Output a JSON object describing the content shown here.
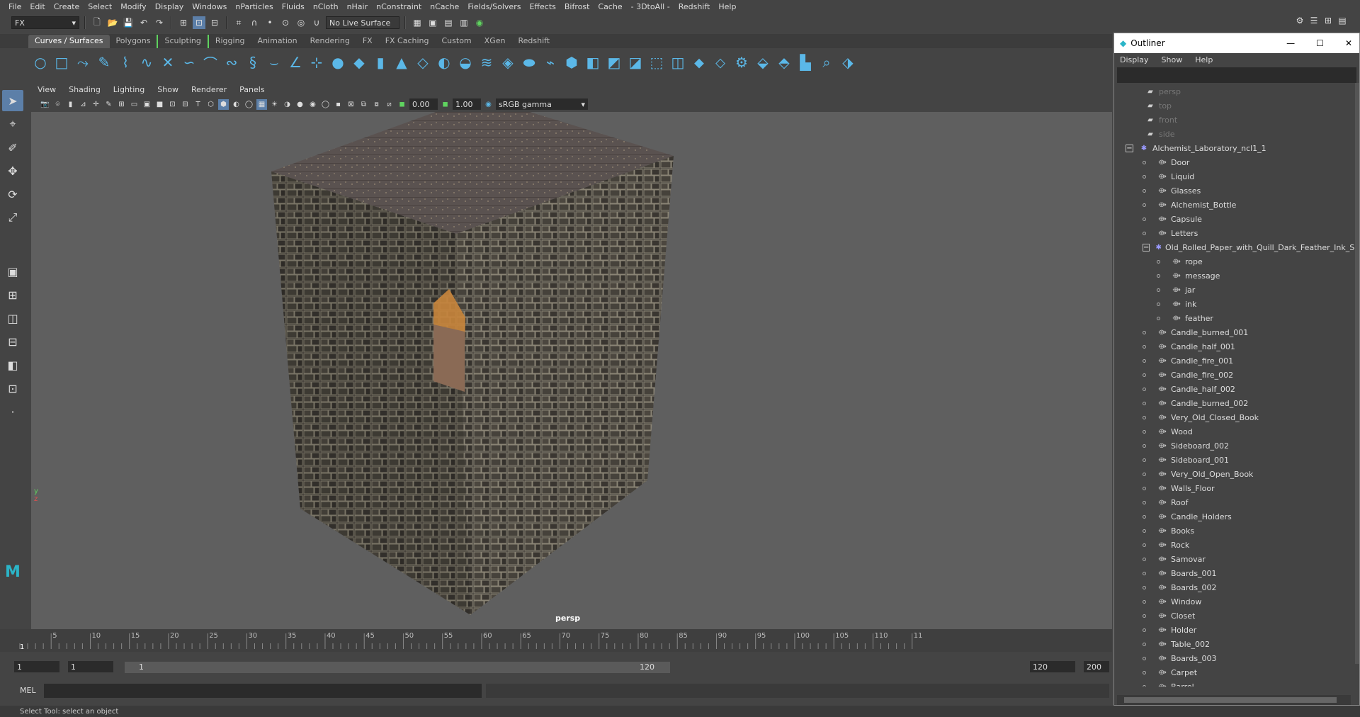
{
  "menubar": [
    "File",
    "Edit",
    "Create",
    "Select",
    "Modify",
    "Display",
    "Windows",
    "nParticles",
    "Fluids",
    "nCloth",
    "nHair",
    "nConstraint",
    "nCache",
    "Fields/Solvers",
    "Effects",
    "Bifrost",
    "Cache",
    "- 3DtoAll -",
    "Redshift",
    "Help"
  ],
  "status": {
    "mode": "FX",
    "live_surface": "No Live Surface"
  },
  "shelf_tabs": [
    "Curves / Surfaces",
    "Polygons",
    "Sculpting",
    "Rigging",
    "Animation",
    "Rendering",
    "FX",
    "FX Caching",
    "Custom",
    "XGen",
    "Redshift"
  ],
  "panel_menu": [
    "View",
    "Shading",
    "Lighting",
    "Show",
    "Renderer",
    "Panels"
  ],
  "panel_toolbar": {
    "exposure": "0.00",
    "gamma": "1.00",
    "colorspace": "sRGB gamma"
  },
  "viewport": {
    "camera": "persp"
  },
  "timeline": {
    "ticks": [
      "5",
      "10",
      "15",
      "20",
      "25",
      "30",
      "35",
      "40",
      "45",
      "50",
      "55",
      "60",
      "65",
      "70",
      "75",
      "80",
      "85",
      "90",
      "95",
      "100",
      "105",
      "110",
      "11"
    ],
    "current": "1"
  },
  "range": {
    "start": "1",
    "playstart": "1",
    "rangestart": "1",
    "rangeend": "120",
    "playend": "120",
    "end": "200"
  },
  "cmdline": {
    "label": "MEL"
  },
  "helpline": "Select Tool: select an object",
  "outliner": {
    "title": "Outliner",
    "menu": [
      "Display",
      "Show",
      "Help"
    ],
    "cameras": [
      "persp",
      "top",
      "front",
      "side"
    ],
    "root": "Alchemist_Laboratory_ncl1_1",
    "children1": [
      "Door",
      "Liquid",
      "Glasses",
      "Alchemist_Bottle",
      "Capsule",
      "Letters"
    ],
    "group2": "Old_Rolled_Paper_with_Quill_Dark_Feather_Ink_Se",
    "children2": [
      "rope",
      "message",
      "jar",
      "ink",
      "feather"
    ],
    "children3": [
      "Candle_burned_001",
      "Candle_half_001",
      "Candle_fire_001",
      "Candle_fire_002",
      "Candle_half_002",
      "Candle_burned_002",
      "Very_Old_Closed_Book",
      "Wood",
      "Sideboard_002",
      "Sideboard_001",
      "Very_Old_Open_Book",
      "Walls_Floor",
      "Roof",
      "Candle_Holders",
      "Books",
      "Rock",
      "Samovar",
      "Boards_001",
      "Boards_002",
      "Window",
      "Closet",
      "Holder",
      "Table_002",
      "Boards_003",
      "Carpet",
      "Barrel"
    ]
  }
}
